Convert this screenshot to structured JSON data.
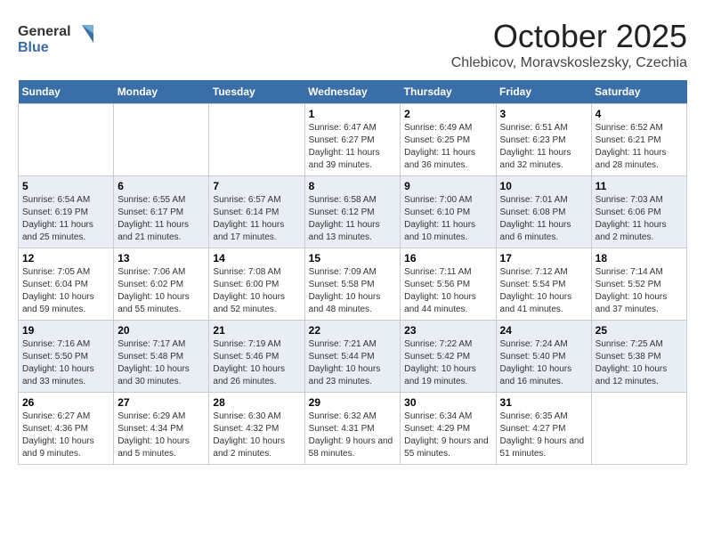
{
  "header": {
    "logo_general": "General",
    "logo_blue": "Blue",
    "month_title": "October 2025",
    "location": "Chlebicov, Moravskoslezsky, Czechia"
  },
  "days_of_week": [
    "Sunday",
    "Monday",
    "Tuesday",
    "Wednesday",
    "Thursday",
    "Friday",
    "Saturday"
  ],
  "weeks": [
    [
      {
        "day": "",
        "info": ""
      },
      {
        "day": "",
        "info": ""
      },
      {
        "day": "",
        "info": ""
      },
      {
        "day": "1",
        "info": "Sunrise: 6:47 AM\nSunset: 6:27 PM\nDaylight: 11 hours and 39 minutes."
      },
      {
        "day": "2",
        "info": "Sunrise: 6:49 AM\nSunset: 6:25 PM\nDaylight: 11 hours and 36 minutes."
      },
      {
        "day": "3",
        "info": "Sunrise: 6:51 AM\nSunset: 6:23 PM\nDaylight: 11 hours and 32 minutes."
      },
      {
        "day": "4",
        "info": "Sunrise: 6:52 AM\nSunset: 6:21 PM\nDaylight: 11 hours and 28 minutes."
      }
    ],
    [
      {
        "day": "5",
        "info": "Sunrise: 6:54 AM\nSunset: 6:19 PM\nDaylight: 11 hours and 25 minutes."
      },
      {
        "day": "6",
        "info": "Sunrise: 6:55 AM\nSunset: 6:17 PM\nDaylight: 11 hours and 21 minutes."
      },
      {
        "day": "7",
        "info": "Sunrise: 6:57 AM\nSunset: 6:14 PM\nDaylight: 11 hours and 17 minutes."
      },
      {
        "day": "8",
        "info": "Sunrise: 6:58 AM\nSunset: 6:12 PM\nDaylight: 11 hours and 13 minutes."
      },
      {
        "day": "9",
        "info": "Sunrise: 7:00 AM\nSunset: 6:10 PM\nDaylight: 11 hours and 10 minutes."
      },
      {
        "day": "10",
        "info": "Sunrise: 7:01 AM\nSunset: 6:08 PM\nDaylight: 11 hours and 6 minutes."
      },
      {
        "day": "11",
        "info": "Sunrise: 7:03 AM\nSunset: 6:06 PM\nDaylight: 11 hours and 2 minutes."
      }
    ],
    [
      {
        "day": "12",
        "info": "Sunrise: 7:05 AM\nSunset: 6:04 PM\nDaylight: 10 hours and 59 minutes."
      },
      {
        "day": "13",
        "info": "Sunrise: 7:06 AM\nSunset: 6:02 PM\nDaylight: 10 hours and 55 minutes."
      },
      {
        "day": "14",
        "info": "Sunrise: 7:08 AM\nSunset: 6:00 PM\nDaylight: 10 hours and 52 minutes."
      },
      {
        "day": "15",
        "info": "Sunrise: 7:09 AM\nSunset: 5:58 PM\nDaylight: 10 hours and 48 minutes."
      },
      {
        "day": "16",
        "info": "Sunrise: 7:11 AM\nSunset: 5:56 PM\nDaylight: 10 hours and 44 minutes."
      },
      {
        "day": "17",
        "info": "Sunrise: 7:12 AM\nSunset: 5:54 PM\nDaylight: 10 hours and 41 minutes."
      },
      {
        "day": "18",
        "info": "Sunrise: 7:14 AM\nSunset: 5:52 PM\nDaylight: 10 hours and 37 minutes."
      }
    ],
    [
      {
        "day": "19",
        "info": "Sunrise: 7:16 AM\nSunset: 5:50 PM\nDaylight: 10 hours and 33 minutes."
      },
      {
        "day": "20",
        "info": "Sunrise: 7:17 AM\nSunset: 5:48 PM\nDaylight: 10 hours and 30 minutes."
      },
      {
        "day": "21",
        "info": "Sunrise: 7:19 AM\nSunset: 5:46 PM\nDaylight: 10 hours and 26 minutes."
      },
      {
        "day": "22",
        "info": "Sunrise: 7:21 AM\nSunset: 5:44 PM\nDaylight: 10 hours and 23 minutes."
      },
      {
        "day": "23",
        "info": "Sunrise: 7:22 AM\nSunset: 5:42 PM\nDaylight: 10 hours and 19 minutes."
      },
      {
        "day": "24",
        "info": "Sunrise: 7:24 AM\nSunset: 5:40 PM\nDaylight: 10 hours and 16 minutes."
      },
      {
        "day": "25",
        "info": "Sunrise: 7:25 AM\nSunset: 5:38 PM\nDaylight: 10 hours and 12 minutes."
      }
    ],
    [
      {
        "day": "26",
        "info": "Sunrise: 6:27 AM\nSunset: 4:36 PM\nDaylight: 10 hours and 9 minutes."
      },
      {
        "day": "27",
        "info": "Sunrise: 6:29 AM\nSunset: 4:34 PM\nDaylight: 10 hours and 5 minutes."
      },
      {
        "day": "28",
        "info": "Sunrise: 6:30 AM\nSunset: 4:32 PM\nDaylight: 10 hours and 2 minutes."
      },
      {
        "day": "29",
        "info": "Sunrise: 6:32 AM\nSunset: 4:31 PM\nDaylight: 9 hours and 58 minutes."
      },
      {
        "day": "30",
        "info": "Sunrise: 6:34 AM\nSunset: 4:29 PM\nDaylight: 9 hours and 55 minutes."
      },
      {
        "day": "31",
        "info": "Sunrise: 6:35 AM\nSunset: 4:27 PM\nDaylight: 9 hours and 51 minutes."
      },
      {
        "day": "",
        "info": ""
      }
    ]
  ]
}
